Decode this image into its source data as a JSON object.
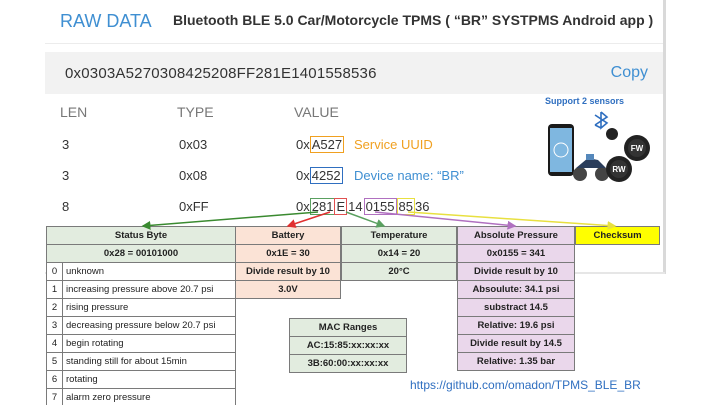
{
  "header": {
    "title": "RAW DATA",
    "subtitle": "Bluetooth BLE 5.0 Car/Motorcycle TPMS ( “BR” SYSTPMS Android app )"
  },
  "raw": {
    "hex": "0x0303A5270308425208FF281E1401558536",
    "copy_label": "Copy"
  },
  "columns": {
    "len": "LEN",
    "type": "TYPE",
    "value": "VALUE"
  },
  "rows": [
    {
      "len": "3",
      "type": "0x03",
      "value_prefix": "0x",
      "value_hl": "A527",
      "note": "Service UUID"
    },
    {
      "len": "3",
      "type": "0x08",
      "value_prefix": "0x",
      "value_hl": "4252",
      "note": "Device name: “BR”"
    },
    {
      "len": "8",
      "type": "0xFF",
      "value_prefix": "0x",
      "seg": [
        "281",
        "E",
        "14",
        "0155",
        "85",
        "36"
      ]
    }
  ],
  "promo": {
    "title": "Support 2 sensors",
    "sensor_front": "FW",
    "sensor_rear": "RW"
  },
  "status_table": {
    "header": "Status Byte",
    "value": "0x28 = 00101000",
    "bits": [
      {
        "n": "0",
        "label": "unknown"
      },
      {
        "n": "1",
        "label": "increasing pressure above 20.7 psi"
      },
      {
        "n": "2",
        "label": "rising pressure"
      },
      {
        "n": "3",
        "label": "decreasing pressure below 20.7 psi"
      },
      {
        "n": "4",
        "label": "begin rotating"
      },
      {
        "n": "5",
        "label": "standing still for about 15min"
      },
      {
        "n": "6",
        "label": "rotating"
      },
      {
        "n": "7",
        "label": "alarm zero pressure"
      }
    ]
  },
  "battery_table": {
    "header": "Battery",
    "rows": [
      "0x1E = 30",
      "Divide result by 10",
      "3.0V"
    ]
  },
  "temperature_table": {
    "header": "Temperature",
    "rows": [
      "0x14 = 20",
      "20°C"
    ]
  },
  "pressure_table": {
    "header": "Absolute Pressure",
    "rows": [
      "0x0155 = 341",
      "Divide result by 10",
      "Absoulute: 34.1 psi",
      "substract 14.5",
      "Relative: 19.6 psi",
      "Divide result by 14.5",
      "Relative: 1.35 bar"
    ]
  },
  "checksum_table": {
    "header": "Checksum"
  },
  "mac_table": {
    "header": "MAC Ranges",
    "rows": [
      "AC:15:85:xx:xx:xx",
      "3B:60:00:xx:xx:xx"
    ]
  },
  "link": "https://github.com/omadon/TPMS_BLE_BR",
  "colors": {
    "accent": "#3f8fd2",
    "status_green": "#e2ecdf",
    "battery": "#fbe3d6",
    "pressure": "#ead7eb",
    "checksum": "#ffff00",
    "uuid_note": "#f0a020"
  }
}
